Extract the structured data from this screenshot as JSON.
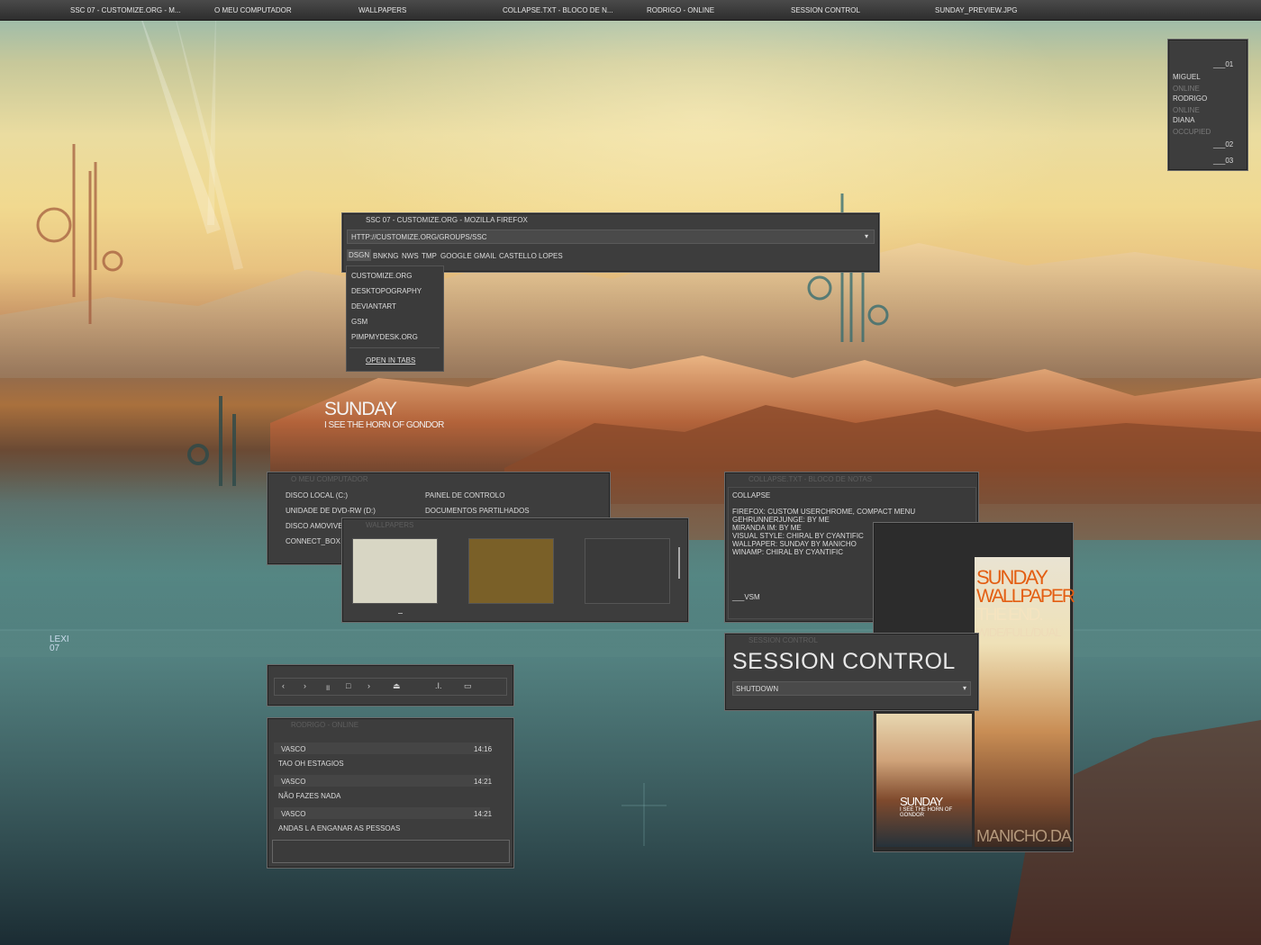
{
  "taskbar": {
    "items": [
      "SSC 07 - CUSTOMIZE.ORG - M...",
      "O MEU COMPUTADOR",
      "WALLPAPERS",
      "COLLAPSE.TXT - BLOCO DE N...",
      "RODRIGO - ONLINE",
      "SESSION CONTROL",
      "SUNDAY_PREVIEW.JPG"
    ]
  },
  "buddy": {
    "group1": "___01",
    "contacts": [
      {
        "name": "MIGUEL",
        "status": "ONLINE"
      },
      {
        "name": "RODRIGO",
        "status": "ONLINE"
      },
      {
        "name": "DIANA",
        "status": "OCCUPIED"
      }
    ],
    "group2": "___02",
    "group3": "___03"
  },
  "firefox": {
    "title": "SSC 07 - CUSTOMIZE.ORG - MOZILLA FIREFOX",
    "url": "HTTP://CUSTOMIZE.ORG/GROUPS/SSC",
    "bookmarks": [
      "DSGN",
      "BNKNG",
      "NWS",
      "TMP",
      "GOOGLE",
      "GMAIL",
      "CASTELLO LOPES"
    ],
    "menu_items": [
      "CUSTOMIZE.ORG",
      "DESKTOPOGRAPHY",
      "DEVIANTART",
      "GSM",
      "PIMPMYDESK.ORG"
    ],
    "menu_open_tabs": "OPEN IN TABS"
  },
  "desktop_text": {
    "headline": "SUNDAY",
    "tagline": "I SEE THE HORN OF GONDOR",
    "logo": "LEXI 07"
  },
  "computer": {
    "title": "O MEU COMPUTADOR",
    "left": [
      "DISCO LOCAL (C:)",
      "UNIDADE DE DVD-RW (D:)",
      "DISCO AMOVIVE",
      "CONNECT_BOX"
    ],
    "right": [
      "PAINEL DE CONTROLO",
      "DOCUMENTOS PARTILHADOS"
    ]
  },
  "wallpapers": {
    "title": "WALLPAPERS",
    "thumb_colors": [
      "#d8d6c4",
      "#7a6028",
      "#3a3a3a"
    ]
  },
  "notepad": {
    "title": "COLLAPSE.TXT - BLOCO DE NOTAS",
    "lines": [
      "COLLAPSE",
      "",
      "FIREFOX: CUSTOM USERCHROME, COMPACT MENU",
      "GEHRUNNERJUNGE: BY ME",
      "MIRANDA IM: BY ME",
      "VISUAL STYLE: CHIRAL BY CYANTIFIC",
      "WALLPAPER: SUNDAY BY MANICHO",
      "WINAMP: CHIRAL BY CYANTIFIC"
    ],
    "signature": "___VSM"
  },
  "session": {
    "title": "SESSION CONTROL",
    "heading": "SESSION CONTROL",
    "select_value": "SHUTDOWN"
  },
  "player": {
    "buttons": [
      "‹",
      "›",
      "॥",
      "□",
      "›",
      "⏏",
      ".ı.",
      "▭"
    ]
  },
  "chat": {
    "title": "RODRIGO - ONLINE",
    "messages": [
      {
        "from": "VASCO",
        "time": "14:16",
        "text": "TAO OH ESTAGIOS"
      },
      {
        "from": "VASCO",
        "time": "14:21",
        "text": "NÃO FAZES NADA"
      },
      {
        "from": "VASCO",
        "time": "14:21",
        "text": "ANDAS L   A ENGANAR AS PESSOAS"
      }
    ]
  },
  "preview": {
    "title": "SUNDAY",
    "subtitle": "WALLPAPER",
    "line3": "THE END.",
    "line4": "WIDE/FULL/DUAL",
    "thumb_title": "SUNDAY",
    "thumb_sub": "I SEE THE HORN OF GONDOR",
    "author": "MANICHO.DA"
  }
}
